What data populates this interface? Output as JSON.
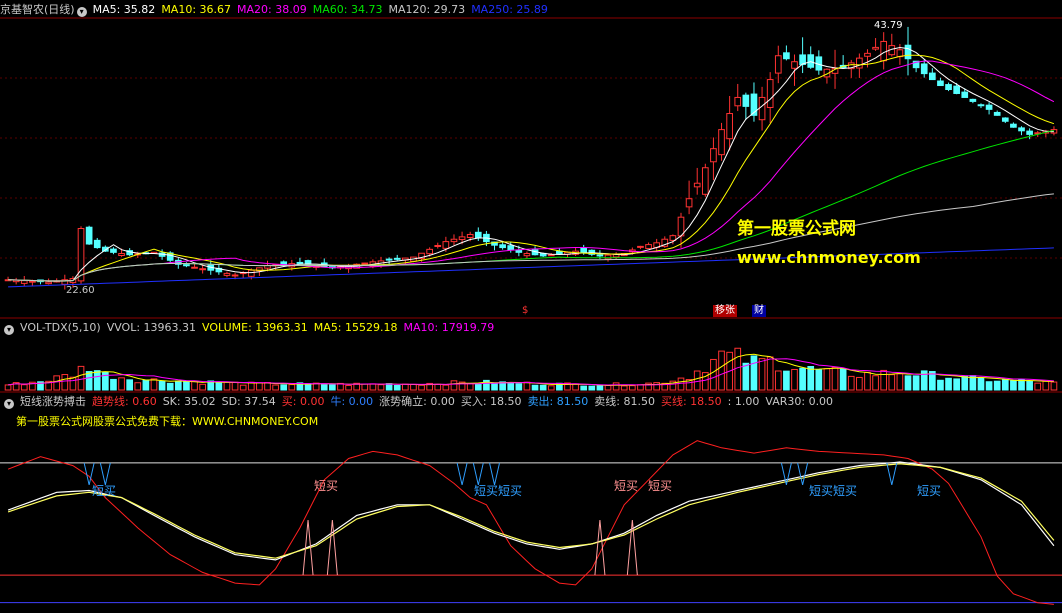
{
  "colors": {
    "up": "#ff3232",
    "down": "#54ffff",
    "ma5": "#ffffff",
    "ma10": "#ffff00",
    "ma20": "#ff00ff",
    "ma60": "#00e600",
    "ma120": "#c8c8c8",
    "ma250": "#2030ff",
    "grid": "#8b0000",
    "watermark": "#ffff00"
  },
  "price_header": {
    "title": "京基智农(日线)",
    "toggle_icon": "chevron-down-icon",
    "ma5": "MA5: 35.82",
    "ma10": "MA10: 36.67",
    "ma20": "MA20: 38.09",
    "ma60": "MA60: 34.73",
    "ma120": "MA120: 29.73",
    "ma250": "MA250: 25.89"
  },
  "price_labels": {
    "high": "43.79",
    "low": "22.60"
  },
  "event_tags": {
    "s": "$",
    "gaizhang": "移张",
    "cai": "财"
  },
  "watermark": {
    "line1": "第一股票公式网",
    "line2": "www.chnmoney.com"
  },
  "vol_header": {
    "title": "VOL-TDX(5,10)",
    "vvol": "VVOL: 13963.31",
    "volume": "VOLUME: 13963.31",
    "ma5": "MA5: 15529.18",
    "ma10": "MA10: 17919.79"
  },
  "ind_header": {
    "title": "短线涨势搏击",
    "trend": "趋势线: 0.60",
    "sk": "SK: 35.02",
    "sd": "SD: 37.54",
    "buy": "买: 0.00",
    "bull": "牛: 0.00",
    "zsqr": "涨势确立: 0.00",
    "mairu": "买入: 18.50",
    "maichu": "卖出: 81.50",
    "maixian": "卖线: 81.50",
    "buyline": "买线: 18.50",
    "ratio": ": 1.00",
    "var30": "VAR30: 0.00"
  },
  "ind_note": "第一股票公式网股票公式免费下载：WWW.CHNMONEY.COM",
  "signals": {
    "short_buy": "短买",
    "short_buy_double": "短买短买"
  },
  "chart_data": [
    {
      "type": "candlestick",
      "title": "京基智农(日线)",
      "n_bars": 130,
      "high_marker": 43.79,
      "low_marker": 22.6,
      "close_anchors": [
        [
          0,
          23.2
        ],
        [
          5,
          23.0
        ],
        [
          8,
          23.3
        ],
        [
          9,
          27.5
        ],
        [
          10,
          26.2
        ],
        [
          12,
          25.6
        ],
        [
          15,
          25.3
        ],
        [
          18,
          25.5
        ],
        [
          21,
          24.5
        ],
        [
          25,
          24.0
        ],
        [
          28,
          23.6
        ],
        [
          32,
          24.4
        ],
        [
          36,
          24.6
        ],
        [
          40,
          24.2
        ],
        [
          45,
          24.7
        ],
        [
          50,
          25.1
        ],
        [
          54,
          26.4
        ],
        [
          57,
          27.0
        ],
        [
          60,
          26.1
        ],
        [
          63,
          25.5
        ],
        [
          66,
          25.2
        ],
        [
          70,
          25.6
        ],
        [
          73,
          25.2
        ],
        [
          76,
          25.4
        ],
        [
          78,
          26.0
        ],
        [
          80,
          26.3
        ],
        [
          82,
          26.9
        ],
        [
          84,
          30.0
        ],
        [
          86,
          32.6
        ],
        [
          88,
          35.8
        ],
        [
          90,
          38.5
        ],
        [
          92,
          37.0
        ],
        [
          94,
          40.0
        ],
        [
          95,
          42.0
        ],
        [
          97,
          41.5
        ],
        [
          100,
          40.8
        ],
        [
          103,
          41.0
        ],
        [
          106,
          42.2
        ],
        [
          108,
          43.2
        ],
        [
          110,
          42.5
        ],
        [
          112,
          41.0
        ],
        [
          115,
          39.5
        ],
        [
          118,
          38.5
        ],
        [
          121,
          37.5
        ],
        [
          124,
          36.0
        ],
        [
          126,
          35.4
        ],
        [
          129,
          35.8
        ]
      ],
      "ma": {
        "MA5": 35.82,
        "MA10": 36.67,
        "MA20": 38.09,
        "MA60": 34.73,
        "MA120": 29.73,
        "MA250": 25.89
      }
    },
    {
      "type": "bar",
      "title": "VOL-TDX(5,10)",
      "vol_anchors": [
        [
          0,
          3000
        ],
        [
          4,
          5000
        ],
        [
          8,
          9000
        ],
        [
          9,
          12000
        ],
        [
          10,
          14000
        ],
        [
          12,
          9000
        ],
        [
          16,
          6000
        ],
        [
          22,
          5000
        ],
        [
          30,
          3500
        ],
        [
          40,
          3200
        ],
        [
          50,
          3500
        ],
        [
          58,
          4500
        ],
        [
          66,
          3500
        ],
        [
          74,
          3000
        ],
        [
          80,
          4000
        ],
        [
          84,
          8000
        ],
        [
          86,
          14000
        ],
        [
          88,
          20000
        ],
        [
          90,
          19000
        ],
        [
          92,
          16000
        ],
        [
          94,
          17000
        ],
        [
          96,
          14000
        ],
        [
          100,
          11000
        ],
        [
          105,
          9000
        ],
        [
          110,
          10000
        ],
        [
          115,
          8000
        ],
        [
          120,
          6000
        ],
        [
          125,
          5000
        ],
        [
          129,
          4000
        ]
      ],
      "values": {
        "VVOL": 13963.31,
        "VOLUME": 13963.31,
        "MA5": 15529.18,
        "MA10": 17919.79
      }
    },
    {
      "type": "line",
      "title": "短线涨势搏击",
      "ylim": [
        0,
        100
      ],
      "buy_line": 18.5,
      "sell_line": 81.5,
      "series": [
        {
          "name": "趋势线",
          "anchors": [
            [
              0,
              78
            ],
            [
              4,
              85
            ],
            [
              8,
              80
            ],
            [
              10,
              74
            ],
            [
              12,
              62
            ],
            [
              16,
              45
            ],
            [
              20,
              30
            ],
            [
              24,
              20
            ],
            [
              28,
              14
            ],
            [
              31,
              13
            ],
            [
              33,
              22
            ],
            [
              36,
              45
            ],
            [
              39,
              72
            ],
            [
              42,
              84
            ],
            [
              45,
              88
            ],
            [
              48,
              86
            ],
            [
              52,
              80
            ],
            [
              55,
              70
            ],
            [
              57,
              62
            ],
            [
              59,
              58
            ],
            [
              62,
              35
            ],
            [
              65,
              22
            ],
            [
              68,
              14
            ],
            [
              70,
              13
            ],
            [
              72,
              22
            ],
            [
              74,
              40
            ],
            [
              76,
              58
            ],
            [
              79,
              72
            ],
            [
              82,
              86
            ],
            [
              85,
              94
            ],
            [
              88,
              90
            ],
            [
              92,
              87
            ],
            [
              96,
              90
            ],
            [
              100,
              88
            ],
            [
              104,
              87
            ],
            [
              108,
              86
            ],
            [
              111,
              84
            ],
            [
              114,
              78
            ],
            [
              116,
              70
            ],
            [
              118,
              55
            ],
            [
              120,
              40
            ],
            [
              122,
              18
            ],
            [
              124,
              8
            ],
            [
              127,
              3
            ],
            [
              129,
              2
            ]
          ]
        },
        {
          "name": "SK",
          "anchors": [
            [
              0,
              55
            ],
            [
              6,
              65
            ],
            [
              10,
              66
            ],
            [
              14,
              62
            ],
            [
              18,
              52
            ],
            [
              23,
              40
            ],
            [
              28,
              30
            ],
            [
              33,
              27
            ],
            [
              38,
              36
            ],
            [
              43,
              52
            ],
            [
              48,
              58
            ],
            [
              52,
              58
            ],
            [
              56,
              50
            ],
            [
              60,
              42
            ],
            [
              64,
              36
            ],
            [
              68,
              33
            ],
            [
              72,
              36
            ],
            [
              76,
              42
            ],
            [
              80,
              52
            ],
            [
              84,
              60
            ],
            [
              90,
              66
            ],
            [
              96,
              72
            ],
            [
              100,
              76
            ],
            [
              105,
              80
            ],
            [
              110,
              82
            ],
            [
              115,
              79
            ],
            [
              120,
              72
            ],
            [
              125,
              58
            ],
            [
              129,
              35
            ]
          ]
        },
        {
          "name": "SD",
          "anchors": [
            [
              0,
              54
            ],
            [
              6,
              63
            ],
            [
              10,
              65
            ],
            [
              14,
              62
            ],
            [
              18,
              53
            ],
            [
              23,
              41
            ],
            [
              28,
              31
            ],
            [
              33,
              28
            ],
            [
              38,
              35
            ],
            [
              43,
              50
            ],
            [
              48,
              57
            ],
            [
              52,
              58
            ],
            [
              56,
              51
            ],
            [
              60,
              43
            ],
            [
              64,
              37
            ],
            [
              68,
              34
            ],
            [
              72,
              36
            ],
            [
              76,
              41
            ],
            [
              80,
              50
            ],
            [
              84,
              58
            ],
            [
              90,
              65
            ],
            [
              96,
              71
            ],
            [
              100,
              75
            ],
            [
              105,
              79
            ],
            [
              110,
              81
            ],
            [
              115,
              79
            ],
            [
              120,
              73
            ],
            [
              125,
              60
            ],
            [
              129,
              38
            ]
          ]
        }
      ],
      "values": {
        "趋势线": 0.6,
        "SK": 35.02,
        "SD": 37.54,
        "买": 0.0,
        "牛": 0.0,
        "涨势确立": 0.0,
        "买入": 18.5,
        "卖出": 81.5,
        "卖线": 81.5,
        "买线": 18.5,
        "VAR30": 0.0
      }
    }
  ]
}
